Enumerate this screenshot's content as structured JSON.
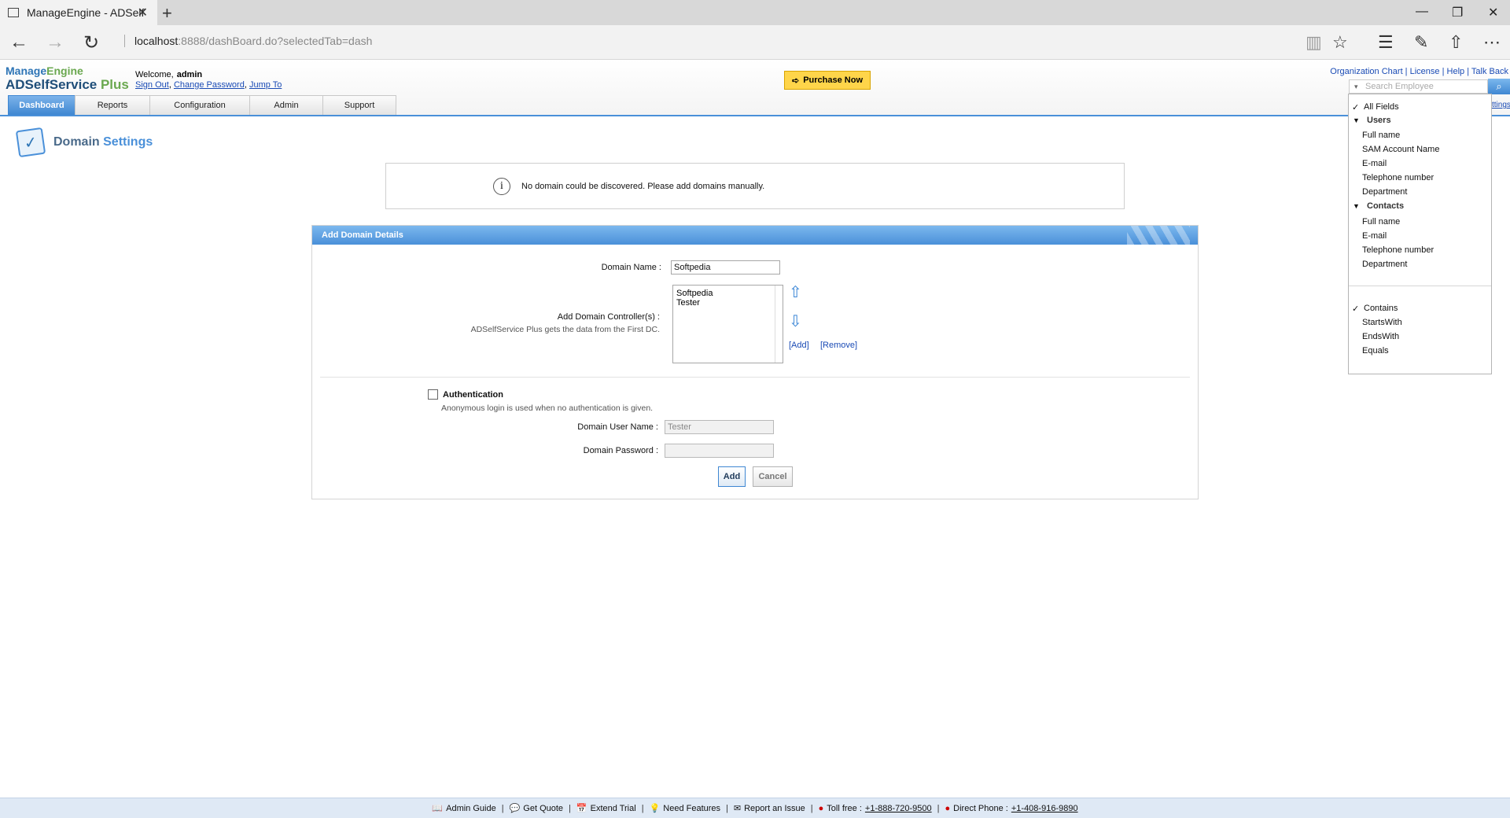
{
  "browser": {
    "tab_title": "ManageEngine - ADSelf",
    "url_host": "localhost",
    "url_rest": ":8888/dashBoard.do?selectedTab=dash"
  },
  "header": {
    "logo_line1a": "Manage",
    "logo_line1b": "Engine",
    "logo_line2a": "ADSelfService",
    "logo_line2b": "Plus",
    "welcome": "Welcome,",
    "user": "admin",
    "sign_out": "Sign Out",
    "change_password": "Change Password",
    "jump_to": "Jump To",
    "purchase": "Purchase Now",
    "links": [
      "Organization Chart",
      "License",
      "Help",
      "Talk Back"
    ],
    "search_placeholder": "Search Employee",
    "settings_fragment": "ttings"
  },
  "nav": [
    "Dashboard",
    "Reports",
    "Configuration",
    "Admin",
    "Support"
  ],
  "page": {
    "title_a": "Domain",
    "title_b": "Settings",
    "info": "No domain could be discovered. Please add domains manually."
  },
  "form": {
    "panel_title": "Add Domain Details",
    "domain_name_label": "Domain Name :",
    "domain_name_value": "Softpedia",
    "dc_label": "Add Domain Controller(s) :",
    "dc_hint": "ADSelfService Plus gets the data from the First DC.",
    "dc_items": [
      "Softpedia",
      "Tester"
    ],
    "add_link": "[Add]",
    "remove_link": "[Remove]",
    "auth_label": "Authentication",
    "auth_hint": "Anonymous login is used when no authentication is given.",
    "user_label": "Domain User Name :",
    "user_value": "Tester",
    "pass_label": "Domain Password :",
    "add_button": "Add",
    "cancel_button": "Cancel"
  },
  "dropdown": {
    "all_fields": "All Fields",
    "users": "Users",
    "user_fields": [
      "Full name",
      "SAM Account Name",
      "E-mail",
      "Telephone number",
      "Department"
    ],
    "contacts": "Contacts",
    "contact_fields": [
      "Full name",
      "E-mail",
      "Telephone number",
      "Department"
    ],
    "match": [
      "Contains",
      "StartsWith",
      "EndsWith",
      "Equals"
    ]
  },
  "footer": {
    "admin_guide": "Admin Guide",
    "get_quote": "Get Quote",
    "extend_trial": "Extend Trial",
    "need_features": "Need Features",
    "report_issue": "Report an Issue",
    "toll_free_label": "Toll free :",
    "toll_free": "+1-888-720-9500",
    "direct_label": "Direct Phone :",
    "direct": "+1-408-916-9890"
  }
}
